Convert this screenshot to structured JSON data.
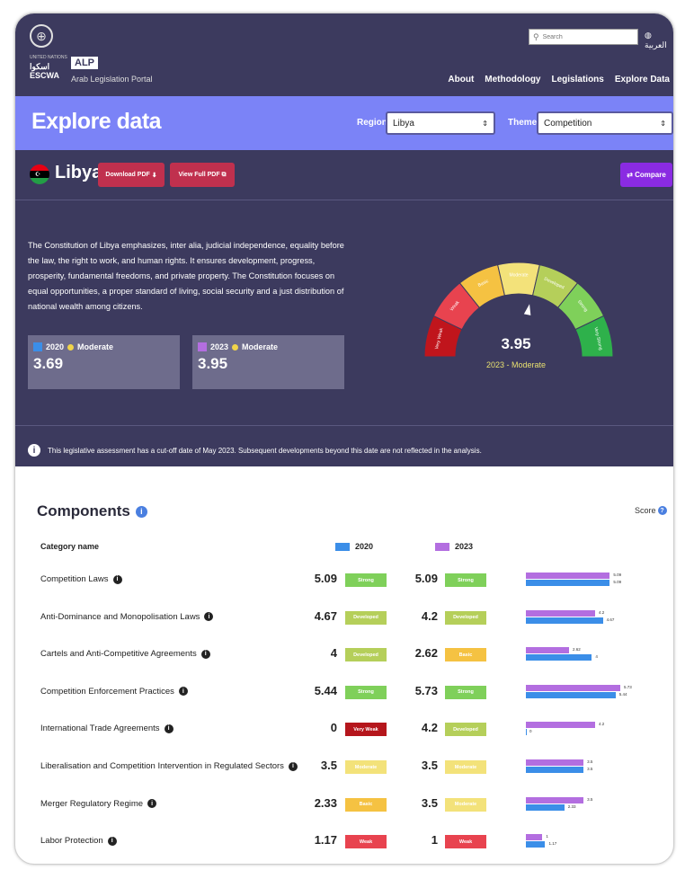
{
  "header": {
    "logo_line1": "اسكوا",
    "logo_line2": "ESCWA",
    "logo_small": "UNITED NATIONS",
    "alp": "ALP",
    "alp_sub": "Arab Legislation Portal",
    "search_placeholder": "Search",
    "language": "العربية",
    "nav": [
      "About",
      "Methodology",
      "Legislations",
      "Explore Data"
    ]
  },
  "banner": {
    "title": "Explore data",
    "region_label": "Region",
    "region_value": "Libya",
    "theme_label": "Theme",
    "theme_value": "Competition"
  },
  "country": {
    "name": "Libya",
    "download_pdf": "Download PDF",
    "view_full_pdf": "View Full PDF",
    "compare": "Compare",
    "description": "The Constitution of Libya emphasizes, inter alia, judicial independence, equality before the law, the right to work, and human rights. It ensures development, progress, prosperity, fundamental freedoms, and private property. The Constitution focuses on equal opportunities, a proper standard of living, social security and a just distribution of national wealth among citizens.",
    "scores": [
      {
        "year": "2020",
        "level": "Moderate",
        "value": "3.69"
      },
      {
        "year": "2023",
        "level": "Moderate",
        "value": "3.95"
      }
    ],
    "gauge": {
      "value": 3.95,
      "value_text": "3.95",
      "label": "2023 - Moderate",
      "segments": [
        "Very Weak",
        "Weak",
        "Basic",
        "Moderate",
        "Developed",
        "Strong",
        "Very Strong"
      ]
    },
    "notice": "This legislative assessment has a cut-off date of May 2023. Subsequent developments beyond this date are not reflected in the analysis."
  },
  "components": {
    "title": "Components",
    "score_label": "Score",
    "col_category": "Category name",
    "legend_2020": "2020",
    "legend_2023": "2023",
    "color_2020": "#3b8ee8",
    "color_2023": "#b36ee0",
    "rows": [
      {
        "name": "Competition Laws",
        "v2020": "5.09",
        "b2020": "Strong",
        "v2023": "5.09",
        "b2023": "Strong",
        "n2020": 5.09,
        "n2023": 5.09
      },
      {
        "name": "Anti-Dominance and Monopolisation Laws",
        "v2020": "4.67",
        "b2020": "Developed",
        "v2023": "4.2",
        "b2023": "Developed",
        "n2020": 4.67,
        "n2023": 4.2
      },
      {
        "name": "Cartels and Anti-Competitive Agreements",
        "v2020": "4",
        "b2020": "Developed",
        "v2023": "2.62",
        "b2023": "Basic",
        "n2020": 4,
        "n2023": 2.62
      },
      {
        "name": "Competition Enforcement Practices",
        "v2020": "5.44",
        "b2020": "Strong",
        "v2023": "5.73",
        "b2023": "Strong",
        "n2020": 5.44,
        "n2023": 5.73
      },
      {
        "name": "International Trade Agreements",
        "v2020": "0",
        "b2020": "Very Weak",
        "v2023": "4.2",
        "b2023": "Developed",
        "n2020": 0,
        "n2023": 4.2
      },
      {
        "name": "Liberalisation and Competition Intervention in Regulated Sectors",
        "v2020": "3.5",
        "b2020": "Moderate",
        "v2023": "3.5",
        "b2023": "Moderate",
        "n2020": 3.5,
        "n2023": 3.5
      },
      {
        "name": "Merger Regulatory Regime",
        "v2020": "2.33",
        "b2020": "Basic",
        "v2023": "3.5",
        "b2023": "Moderate",
        "n2020": 2.33,
        "n2023": 3.5
      },
      {
        "name": "Labor Protection",
        "v2020": "1.17",
        "b2020": "Weak",
        "v2023": "1",
        "b2023": "Weak",
        "n2020": 1.17,
        "n2023": 1
      }
    ],
    "badge_colors": {
      "Strong": "#7fd05a",
      "Developed": "#b5cf5a",
      "Basic": "#f5c242",
      "Moderate": "#f3e27a",
      "Weak": "#e8434f",
      "Very Weak": "#b5161c"
    }
  }
}
